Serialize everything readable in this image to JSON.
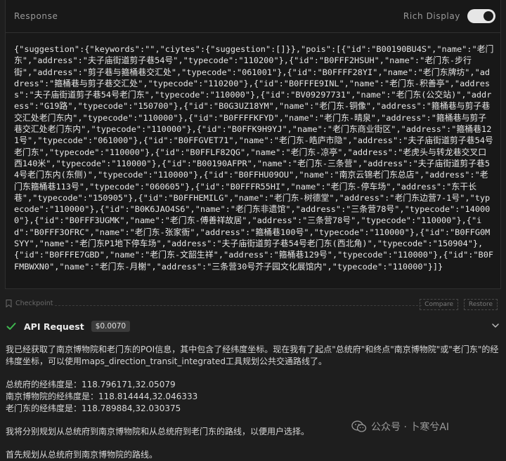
{
  "panel": {
    "title": "Response",
    "rich_display_label": "Rich Display",
    "rich_display_on": true,
    "json_text": "{\"suggestion\":{\"keywords\":\"\",\"ciytes\":{\"suggestion\":[]}},\"pois\":[{\"id\":\"B00190BU4S\",\"name\":\"老门东\",\"address\":\"夫子庙街道剪子巷54号\",\"typecode\":\"110200\"},{\"id\":\"B0FFF2HSUH\",\"name\":\"老门东-步行街\",\"address\":\"剪子巷与箍桶巷交汇处\",\"typecode\":\"061001\"},{\"id\":\"B0FFFF28YI\",\"name\":\"老门东牌坊\",\"address\":\"箍桶巷与剪子巷交汇处\",\"typecode\":\"110200\"},{\"id\":\"B0FFFE9INL\",\"name\":\"老门东-积善亭\",\"address\":\"夫子庙街道剪子巷54号老门东\",\"typecode\":\"110000\"},{\"id\":\"BV09297731\",\"name\":\"老门东(公交站)\",\"address\":\"G19路\",\"typecode\":\"150700\"},{\"id\":\"B0G3UZ18YM\",\"name\":\"老门东-铜像\",\"address\":\"箍桶巷与剪子巷交汇处老门东内\",\"typecode\":\"110000\"},{\"id\":\"B0FFFFKFYD\",\"name\":\"老门东-晴泉\",\"address\":\"箍桶巷与剪子巷交汇处老门东内\",\"typecode\":\"110000\"},{\"id\":\"B0FFK9H9YJ\",\"name\":\"老门东商业街区\",\"address\":\"箍桶巷121号\",\"typecode\":\"061000\"},{\"id\":\"B0FFGVET71\",\"name\":\"老门东-皓庐市隐\",\"address\":\"夫子庙街道剪子巷54号老门东\",\"typecode\":\"110000\"},{\"id\":\"B0FFLF82QG\",\"name\":\"老门东-凉亭\",\"address\":\"老虎头与转龙巷交叉口西140米\",\"typecode\":\"110000\"},{\"id\":\"B00190AFPR\",\"name\":\"老门东-三条营\",\"address\":\"夫子庙街道剪子巷54号老门东内(东侧)\",\"typecode\":\"110000\"},{\"id\":\"B0FFHU09OU\",\"name\":\"南京云锦老门东总店\",\"address\":\"老门东箍桶巷113号\",\"typecode\":\"060605\"},{\"id\":\"B0FFFR55HI\",\"name\":\"老门东-停车场\",\"address\":\"东干长巷\",\"typecode\":\"150905\"},{\"id\":\"B0FFHEMILG\",\"name\":\"老门东-树德堂\",\"address\":\"老门东边营7-1号\",\"typecode\":\"110000\"},{\"id\":\"B0K6JAO4S6\",\"name\":\"老门东非遗馆\",\"address\":\"三条营78号\",\"typecode\":\"140000\"},{\"id\":\"B0FFF3UGMK\",\"name\":\"老门东-傅善祥故居\",\"address\":\"三条营78号\",\"typecode\":\"110000\"},{\"id\":\"B0FFF3OFRC\",\"name\":\"老门东-张家衙\",\"address\":\"箍桶巷100号\",\"typecode\":\"110000\"},{\"id\":\"B0FFG0MSYY\",\"name\":\"老门东P1地下停车场\",\"address\":\"夫子庙街道剪子巷54号老门东(西北角)\",\"typecode\":\"150904\"},{\"id\":\"B0FFFE7GBD\",\"name\":\"老门东-文韶生祥\",\"address\":\"箍桶巷129号\",\"typecode\":\"110000\"},{\"id\":\"B0FFMBWXN0\",\"name\":\"老门东-月榭\",\"address\":\"三条营30号芥子园文化展馆内\",\"typecode\":\"110000\"}]}"
  },
  "checkpoint": {
    "label": "Checkpoint",
    "compare_label": "Compare",
    "restore_label": "Restore"
  },
  "api_request": {
    "title": "API Request",
    "cost": "$0.0070",
    "status_icon": "check-icon",
    "success_color": "#3fb950"
  },
  "message": {
    "paragraph1": "我已经获取了南京博物院和老门东的POI信息，其中包含了经纬度坐标。现在我有了起点\"总统府\"和终点\"南京博物院\"或\"老门东\"的经纬度坐标，可以使用maps_direction_transit_integrated工具规划公共交通路线了。",
    "coords": [
      "总统府的经纬度是：118.796171,32.05079",
      "南京博物院的经纬度是：118.814444,32.046333",
      "老门东的经纬度是：118.789884,32.030375"
    ],
    "paragraph3": "我将分别规划从总统府到南京博物院和从总统府到老门东的路线，以便用户选择。",
    "paragraph4": "首先规划从总统府到南京博物院的路线。"
  },
  "watermark": {
    "text": "公众号 · 卜寒兮AI"
  }
}
